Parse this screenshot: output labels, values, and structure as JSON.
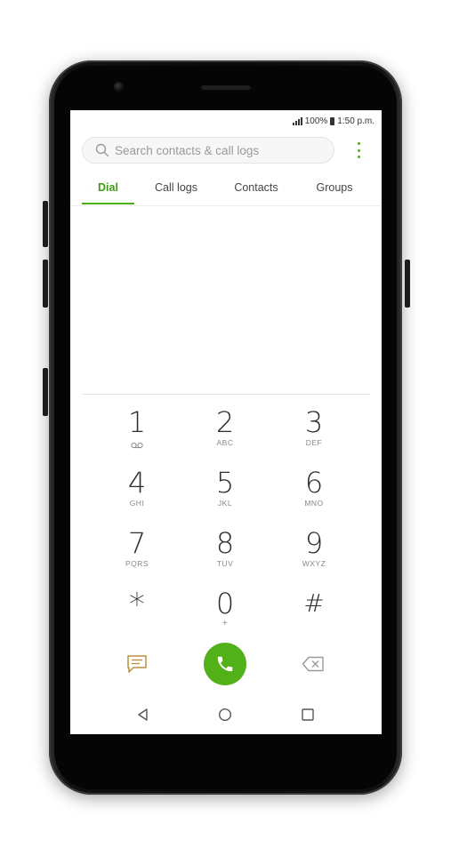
{
  "status": {
    "battery": "100%",
    "time": "1:50 p.m."
  },
  "search": {
    "placeholder": "Search contacts & call logs"
  },
  "tabs": [
    {
      "label": "Dial"
    },
    {
      "label": "Call logs"
    },
    {
      "label": "Contacts"
    },
    {
      "label": "Groups"
    }
  ],
  "keypad": [
    {
      "digit": "1",
      "letters": ""
    },
    {
      "digit": "2",
      "letters": "ABC"
    },
    {
      "digit": "3",
      "letters": "DEF"
    },
    {
      "digit": "4",
      "letters": "GHI"
    },
    {
      "digit": "5",
      "letters": "JKL"
    },
    {
      "digit": "6",
      "letters": "MNO"
    },
    {
      "digit": "7",
      "letters": "PQRS"
    },
    {
      "digit": "8",
      "letters": "TUV"
    },
    {
      "digit": "9",
      "letters": "WXYZ"
    },
    {
      "digit": "*",
      "letters": ""
    },
    {
      "digit": "0",
      "letters": "+"
    },
    {
      "digit": "#",
      "letters": ""
    }
  ],
  "icons": {
    "voicemail": "voicemail-icon",
    "message": "message-icon",
    "call": "phone-icon",
    "backspace": "backspace-icon",
    "back": "back-triangle-icon",
    "home": "home-circle-icon",
    "recents": "recents-square-icon"
  },
  "colors": {
    "accent": "#4eae16",
    "call_button": "#52b018",
    "message_icon": "#b8903a"
  }
}
